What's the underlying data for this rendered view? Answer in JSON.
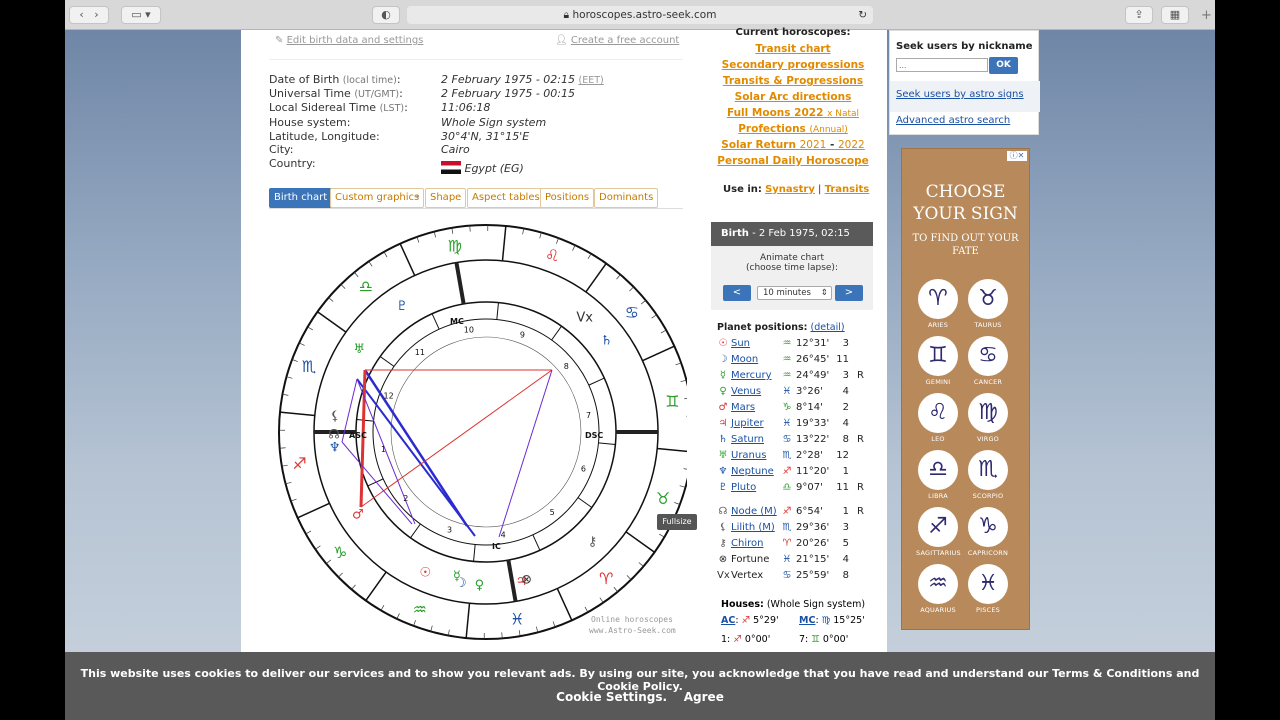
{
  "browser": {
    "url": "horoscopes.astro-seek.com",
    "back_icon": "chevron-left-icon",
    "forward_icon": "chevron-right-icon"
  },
  "links": {
    "edit": "Edit birth data and settings",
    "create": "Create a free account"
  },
  "birth_info": [
    {
      "label": "Date of Birth",
      "note": "(local time)",
      "value": "2 February 1975 - 02:15",
      "extra": "(EET)"
    },
    {
      "label": "Universal Time",
      "note": "(UT/GMT)",
      "value": "2 February 1975 - 00:15",
      "extra": ""
    },
    {
      "label": "Local Sidereal Time",
      "note": "(LST)",
      "value": "11:06:18",
      "extra": ""
    },
    {
      "label": "House system:",
      "note": "",
      "value": "Whole Sign system",
      "extra": ""
    },
    {
      "label": "Latitude, Longitude:",
      "note": "",
      "value": "30°4'N, 31°15'E",
      "extra": ""
    },
    {
      "label": "City:",
      "note": "",
      "value": "Cairo",
      "extra": ""
    },
    {
      "label": "Country:",
      "note": "",
      "value": "Egypt (EG)",
      "extra": ""
    }
  ],
  "tabs": [
    "Birth chart",
    "Custom graphics",
    "-",
    "Shape",
    "Aspect tables",
    "Positions",
    "Dominants"
  ],
  "wheel": {
    "signs": [
      "♈",
      "♉",
      "♊",
      "♋",
      "♌",
      "♍",
      "♎",
      "♏",
      "♐",
      "♑",
      "♒",
      "♓"
    ],
    "angle_labels": {
      "asc": "ASC",
      "dsc": "DSC",
      "mc": "MC",
      "ic": "IC"
    },
    "houses": [
      "1",
      "2",
      "3",
      "4",
      "5",
      "6",
      "7",
      "8",
      "9",
      "10",
      "11",
      "12"
    ],
    "credit1": "Online horoscopes",
    "credit2": "www.Astro-Seek.com",
    "fullsize": "Fullsize"
  },
  "current": {
    "title": "Current horoscopes:",
    "items": [
      "Transit chart",
      "Secondary progressions",
      "Transits & Progressions",
      "Solar Arc directions"
    ],
    "full_moons": "Full Moons 2022",
    "full_moons_note": "x Natal",
    "profections": "Profections",
    "profections_note": "(Annual)",
    "solar_return": "Solar Return",
    "sr_y1": "2021",
    "sr_y2": "2022",
    "daily": "Personal Daily Horoscope",
    "use_in": "Use in:",
    "synastry": "Synastry",
    "transits": "Transits"
  },
  "birth_box": {
    "title": "Birth",
    "date": "- 2 Feb 1975, 02:15",
    "animate": "Animate chart",
    "lapse": "(choose time lapse):",
    "select": "10 minutes",
    "prev": "<",
    "next": ">"
  },
  "planets_title": "Planet positions:",
  "planets_detail": "(detail)",
  "planets": [
    {
      "glyph": "☉",
      "name": "Sun",
      "sign": "♒",
      "deg": "12°31'",
      "house": "3",
      "r": ""
    },
    {
      "glyph": "☽",
      "name": "Moon",
      "sign": "♒",
      "deg": "26°45'",
      "house": "11",
      "r": ""
    },
    {
      "glyph": "☿",
      "name": "Mercury",
      "sign": "♒",
      "deg": "24°49'",
      "house": "3",
      "r": "R"
    },
    {
      "glyph": "♀",
      "name": "Venus",
      "sign": "♓",
      "deg": "3°26'",
      "house": "4",
      "r": ""
    },
    {
      "glyph": "♂",
      "name": "Mars",
      "sign": "♑",
      "deg": "8°14'",
      "house": "2",
      "r": ""
    },
    {
      "glyph": "♃",
      "name": "Jupiter",
      "sign": "♓",
      "deg": "19°33'",
      "house": "4",
      "r": ""
    },
    {
      "glyph": "♄",
      "name": "Saturn",
      "sign": "♋",
      "deg": "13°22'",
      "house": "8",
      "r": "R"
    },
    {
      "glyph": "♅",
      "name": "Uranus",
      "sign": "♏",
      "deg": "2°28'",
      "house": "12",
      "r": ""
    },
    {
      "glyph": "♆",
      "name": "Neptune",
      "sign": "♐",
      "deg": "11°20'",
      "house": "1",
      "r": ""
    },
    {
      "glyph": "♇",
      "name": "Pluto",
      "sign": "♎",
      "deg": "9°07'",
      "house": "11",
      "r": "R"
    },
    {
      "glyph": "☊",
      "name": "Node (M)",
      "sign": "♐",
      "deg": "6°54'",
      "house": "1",
      "r": "R"
    },
    {
      "glyph": "⚸",
      "name": "Lilith (M)",
      "sign": "♏",
      "deg": "29°36'",
      "house": "3",
      "r": ""
    },
    {
      "glyph": "⚷",
      "name": "Chiron",
      "sign": "♈",
      "deg": "20°26'",
      "house": "5",
      "r": ""
    },
    {
      "glyph": "⊗",
      "name": "Fortune",
      "sign": "♓",
      "deg": "21°15'",
      "house": "4",
      "r": ""
    },
    {
      "glyph": "Vx",
      "name": "Vertex",
      "sign": "♋",
      "deg": "25°59'",
      "house": "8",
      "r": ""
    }
  ],
  "houses": {
    "title": "Houses:",
    "system": "(Whole Sign system)",
    "ac_label": "AC",
    "ac_sign": "♐",
    "ac_deg": "5°29'",
    "mc_label": "MC",
    "mc_sign": "♍",
    "mc_deg": "15°25'",
    "h1": "1:",
    "h1_sign": "♐",
    "h1_deg": "0°00'",
    "h7": "7:",
    "h7_sign": "♊",
    "h7_deg": "0°00'"
  },
  "seek": {
    "title": "Seek users by nickname",
    "placeholder": "...",
    "ok": "OK",
    "by_signs": "Seek users by astro signs",
    "advanced": "Advanced astro search"
  },
  "ad": {
    "title1": "CHOOSE",
    "title2": "YOUR SIGN",
    "sub": "TO FIND OUT YOUR FATE",
    "signs": [
      {
        "g": "♈",
        "n": "ARIES"
      },
      {
        "g": "♉",
        "n": "TAURUS"
      },
      {
        "g": "♊",
        "n": "GEMINI"
      },
      {
        "g": "♋",
        "n": "CANCER"
      },
      {
        "g": "♌",
        "n": "LEO"
      },
      {
        "g": "♍",
        "n": "VIRGO"
      },
      {
        "g": "♎",
        "n": "LIBRA"
      },
      {
        "g": "♏",
        "n": "SCORPIO"
      },
      {
        "g": "♐",
        "n": "SAGITTARIUS"
      },
      {
        "g": "♑",
        "n": "CAPRICORN"
      },
      {
        "g": "♒",
        "n": "AQUARIUS"
      },
      {
        "g": "♓",
        "n": "PISCES"
      }
    ]
  },
  "cookie": {
    "text": "This website uses cookies to deliver our services and to show you relevant ads. By using our site, you acknowledge that you have read and understand our Terms & Conditions and Cookie Policy.",
    "settings": "Cookie Settings.",
    "agree": "Agree"
  }
}
